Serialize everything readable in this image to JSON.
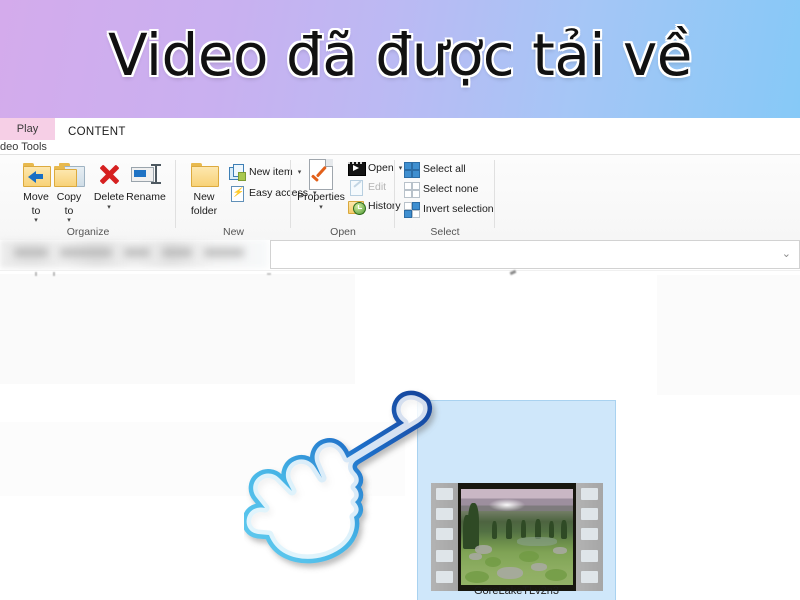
{
  "banner": {
    "title": "Video đã được tải về",
    "gradient_from": "#d4abec",
    "gradient_to": "#86c9f7"
  },
  "explorer": {
    "tabs": {
      "contextual_label": "deo Tools",
      "contextual_tab": "Play",
      "contextual_tab_color": "#f6cfe6",
      "active_tab": "CONTENT"
    },
    "ribbon": {
      "groups": [
        {
          "name": "Organize",
          "label": "Organize",
          "big_buttons": [
            {
              "label_line1": "Move",
              "label_line2": "to",
              "caret": "▾",
              "icon": "move-to-folder-icon"
            },
            {
              "label_line1": "Copy",
              "label_line2": "to",
              "caret": "▾",
              "icon": "copy-to-folder-icon"
            },
            {
              "label_line1": "Delete",
              "label_line2": "",
              "caret": "▾",
              "icon": "delete-red-x-icon"
            },
            {
              "label_line1": "Rename",
              "label_line2": "",
              "caret": "",
              "icon": "rename-icon"
            }
          ]
        },
        {
          "name": "New",
          "label": "New",
          "big_buttons": [
            {
              "label_line1": "New",
              "label_line2": "folder",
              "caret": "",
              "icon": "new-folder-icon"
            }
          ],
          "small_buttons": [
            {
              "label": "New item",
              "caret": "▾",
              "icon": "new-item-icon",
              "disabled": false
            },
            {
              "label": "Easy access",
              "caret": "▾",
              "icon": "easy-access-icon",
              "disabled": false
            }
          ]
        },
        {
          "name": "Open",
          "label": "Open",
          "big_buttons": [
            {
              "label_line1": "Properties",
              "label_line2": "",
              "caret": "▾",
              "icon": "properties-icon"
            }
          ],
          "small_buttons": [
            {
              "label": "Open",
              "caret": "▾",
              "icon": "open-media-icon",
              "disabled": false
            },
            {
              "label": "Edit",
              "caret": "",
              "icon": "edit-icon",
              "disabled": true
            },
            {
              "label": "History",
              "caret": "",
              "icon": "history-icon",
              "disabled": false
            }
          ]
        },
        {
          "name": "Select",
          "label": "Select",
          "small_buttons": [
            {
              "label": "Select all",
              "caret": "",
              "icon": "select-all-icon",
              "disabled": false
            },
            {
              "label": "Select none",
              "caret": "",
              "icon": "select-none-icon",
              "disabled": false
            },
            {
              "label": "Invert selection",
              "caret": "",
              "icon": "invert-selection-icon",
              "disabled": false
            }
          ]
        }
      ]
    },
    "address_bar": {
      "value": "",
      "blurred": true
    },
    "search_box": {
      "value": "",
      "placeholder": "",
      "caret_icon": "chevron-down-icon",
      "caret_glyph": "⌄"
    },
    "content": {
      "selected_item": {
        "name": "GoreLakeTLv2n3",
        "type": "video",
        "thumbnail": "film-strip-mountain-lake-thumbnail",
        "selected": true,
        "selection_color": "#cfe7fa"
      }
    }
  },
  "cursor": {
    "type": "pointing-hand-cursor",
    "color_light": "#5ec8ef",
    "color_dark": "#1a4fa8"
  }
}
